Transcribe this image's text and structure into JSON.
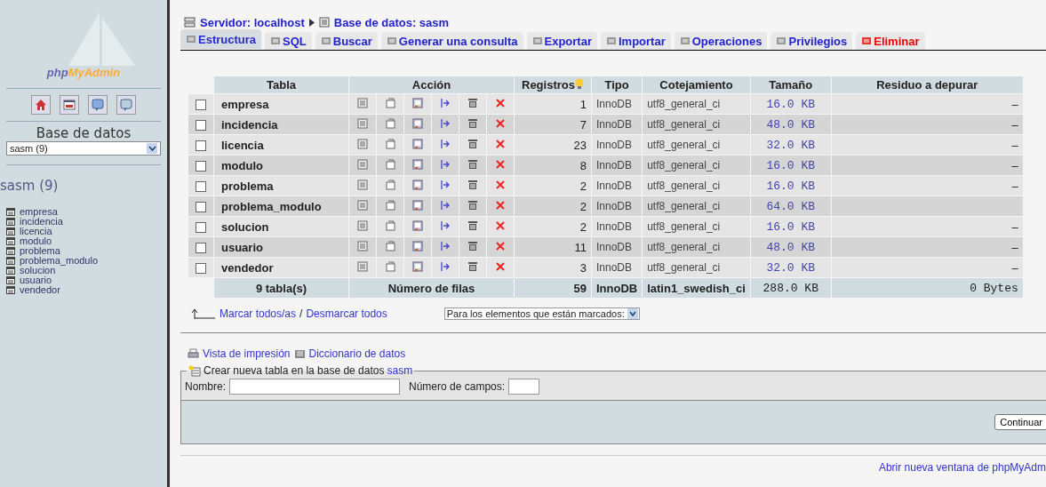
{
  "sidebar": {
    "logo": {
      "prefix": "php",
      "suffix": "MyAdmin"
    },
    "db_label": "Base de datos",
    "db_select": "sasm (9)",
    "db_heading": "sasm (9)",
    "tables": [
      "empresa",
      "incidencia",
      "licencia",
      "modulo",
      "problema",
      "problema_modulo",
      "solucion",
      "usuario",
      "vendedor"
    ]
  },
  "breadcrumb": {
    "server": "Servidor: localhost",
    "database": "Base de datos: sasm"
  },
  "tabs": [
    {
      "label": "Estructura",
      "selected": true,
      "kind": "normal"
    },
    {
      "label": "SQL",
      "selected": false,
      "kind": "normal"
    },
    {
      "label": "Buscar",
      "selected": false,
      "kind": "normal"
    },
    {
      "label": "Generar una consulta",
      "selected": false,
      "kind": "normal"
    },
    {
      "label": "Exportar",
      "selected": false,
      "kind": "normal"
    },
    {
      "label": "Importar",
      "selected": false,
      "kind": "normal"
    },
    {
      "label": "Operaciones",
      "selected": false,
      "kind": "normal"
    },
    {
      "label": "Privilegios",
      "selected": false,
      "kind": "normal"
    },
    {
      "label": "Eliminar",
      "selected": false,
      "kind": "danger"
    }
  ],
  "table": {
    "columns": [
      "Tabla",
      "Acción",
      "Registros",
      "Tipo",
      "Cotejamiento",
      "Tamaño",
      "Residuo a depurar"
    ],
    "rows": [
      {
        "checked": false,
        "name": "empresa",
        "records": "1",
        "type": "InnoDB",
        "collation": "utf8_general_ci",
        "size": "16.0 KB",
        "overhead": "–"
      },
      {
        "checked": false,
        "name": "incidencia",
        "records": "7",
        "type": "InnoDB",
        "collation": "utf8_general_ci",
        "size": "48.0 KB",
        "overhead": "–"
      },
      {
        "checked": false,
        "name": "licencia",
        "records": "23",
        "type": "InnoDB",
        "collation": "utf8_general_ci",
        "size": "32.0 KB",
        "overhead": "–"
      },
      {
        "checked": false,
        "name": "modulo",
        "records": "8",
        "type": "InnoDB",
        "collation": "utf8_general_ci",
        "size": "16.0 KB",
        "overhead": "–"
      },
      {
        "checked": false,
        "name": "problema",
        "records": "2",
        "type": "InnoDB",
        "collation": "utf8_general_ci",
        "size": "16.0 KB",
        "overhead": "–"
      },
      {
        "checked": false,
        "name": "problema_modulo",
        "records": "2",
        "type": "InnoDB",
        "collation": "utf8_general_ci",
        "size": "64.0 KB"
      },
      {
        "checked": false,
        "name": "solucion",
        "records": "2",
        "type": "InnoDB",
        "collation": "utf8_general_ci",
        "size": "16.0 KB",
        "overhead": "–"
      },
      {
        "checked": false,
        "name": "usuario",
        "records": "11",
        "type": "InnoDB",
        "collation": "utf8_general_ci",
        "size": "48.0 KB",
        "overhead": "–"
      },
      {
        "checked": false,
        "name": "vendedor",
        "records": "3",
        "type": "InnoDB",
        "collation": "utf8_general_ci",
        "size": "32.0 KB",
        "overhead": "–"
      }
    ],
    "footer": {
      "count": "9 tabla(s)",
      "label": "Número de filas",
      "records": "59",
      "type": "InnoDB",
      "collation": "latin1_swedish_ci",
      "size": "288.0 KB",
      "overhead": "0 Bytes"
    }
  },
  "check_links": {
    "check_all": "Marcar todos/as",
    "separator": "/",
    "uncheck_all": "Desmarcar todos"
  },
  "with_selected": "Para los elementos que están marcados:",
  "links": {
    "print": "Vista de impresión",
    "dictionary": "Diccionario de datos"
  },
  "create": {
    "legend": "Crear nueva tabla en la base de datos",
    "db": "sasm",
    "name_label": "Nombre:",
    "fields_label": "Número de campos:",
    "button": "Continuar"
  },
  "footer_link": "Abrir nueva ventana de phpMyAdm"
}
